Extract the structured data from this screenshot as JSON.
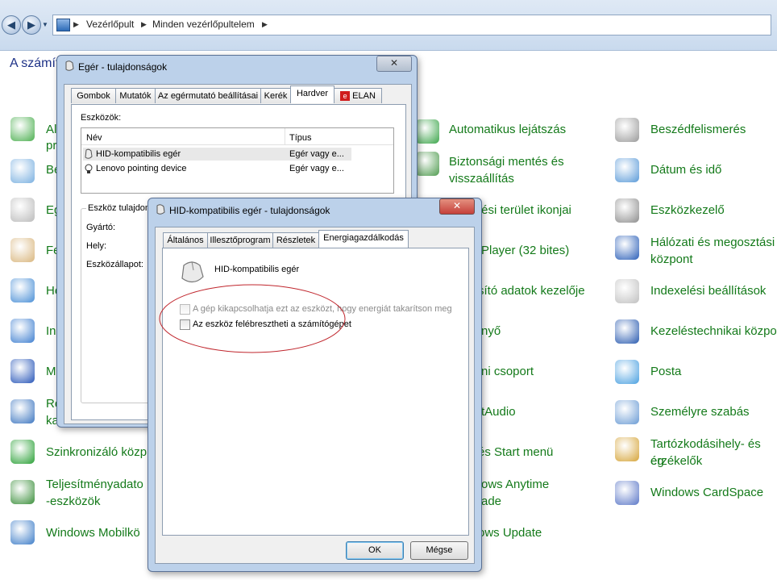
{
  "explorer": {
    "breadcrumb": [
      "Vezérlőpult",
      "Minden vezérlőpultelem"
    ],
    "header": "A számít"
  },
  "control_panel": {
    "left_items": [
      "Al",
      "pr",
      "Be",
      "Eg",
      "Fe",
      "He",
      "In",
      "M",
      "Re",
      "ka",
      "Szinkronizáló közp",
      "Teljesítményadato",
      "-eszközök",
      "Windows Mobilkö"
    ],
    "middle_items": [
      {
        "lines": [
          "Automatikus lejátszás"
        ]
      },
      {
        "lines": [
          "Biztonsági mentés és",
          "visszaállítás"
        ]
      },
      {
        "lines": [
          "tési terület ikonjai"
        ]
      },
      {
        "lines": [
          "Player (32 bites)"
        ]
      },
      {
        "lines": [
          "sító adatok kezelője"
        ]
      },
      {
        "lines": [
          "nyő"
        ]
      },
      {
        "lines": [
          "ni csoport"
        ]
      },
      {
        "lines": [
          "tAudio"
        ]
      },
      {
        "lines": [
          "és Start menü"
        ]
      },
      {
        "lines": [
          "ows Anytime",
          "ade"
        ]
      },
      {
        "lines": [
          "ows Update"
        ]
      }
    ],
    "right_items": [
      {
        "lines": [
          "Beszédfelismerés"
        ],
        "icon": "microphone-icon"
      },
      {
        "lines": [
          "Dátum és idő"
        ],
        "icon": "calendar-icon"
      },
      {
        "lines": [
          "Eszközkezelő"
        ],
        "icon": "device-manager-icon"
      },
      {
        "lines": [
          "Hálózati és megosztási",
          "központ"
        ],
        "icon": "network-icon"
      },
      {
        "lines": [
          "Indexelési beállítások"
        ],
        "icon": "index-icon"
      },
      {
        "lines": [
          "Kezeléstechnikai közpo"
        ],
        "icon": "accessibility-icon"
      },
      {
        "lines": [
          "Posta"
        ],
        "icon": "mail-icon"
      },
      {
        "lines": [
          "Személyre szabás"
        ],
        "icon": "personalize-icon"
      },
      {
        "lines": [
          "Tartózkodási­hely- és eg",
          "érzékelők"
        ],
        "icon": "location-icon"
      },
      {
        "lines": [
          "Windows CardSpace"
        ],
        "icon": "cardspace-icon"
      }
    ]
  },
  "mouse_dialog": {
    "title": "Egér - tulajdonságok",
    "close": "✕",
    "tabs": [
      "Gombok",
      "Mutatók",
      "Az egérmutató beállításai",
      "Kerék",
      "Hardver",
      "ELAN"
    ],
    "active_tab": "Hardver",
    "devices_label": "Eszközök:",
    "columns": [
      "Név",
      "Típus"
    ],
    "rows": [
      {
        "name": "HID-kompatibilis egér",
        "type": "Egér vagy e..."
      },
      {
        "name": "Lenovo pointing device",
        "type": "Egér vagy e..."
      }
    ],
    "props_group": "Eszköz tulajdon",
    "props": [
      "Gyártó:",
      "Hely:",
      "Eszközállapot:"
    ]
  },
  "hid_dialog": {
    "title": "HID-kompatibilis egér - tulajdonságok",
    "close": "✕",
    "tabs": [
      "Általános",
      "Illesztőprogram",
      "Részletek",
      "Energiagazdálkodás"
    ],
    "active_tab": "Energiagazdálkodás",
    "device_name": "HID-kompatibilis egér",
    "option1": "A gép kikapcsolhatja ezt az eszközt, hogy energiát takarítson meg",
    "option2": "Az eszköz felébresztheti a számítógépet",
    "ok": "OK",
    "cancel": "Mégse"
  },
  "colors": {
    "link": "#147a1a",
    "highlight_ellipse": "#c0262d",
    "close_button": "#c5403a"
  }
}
